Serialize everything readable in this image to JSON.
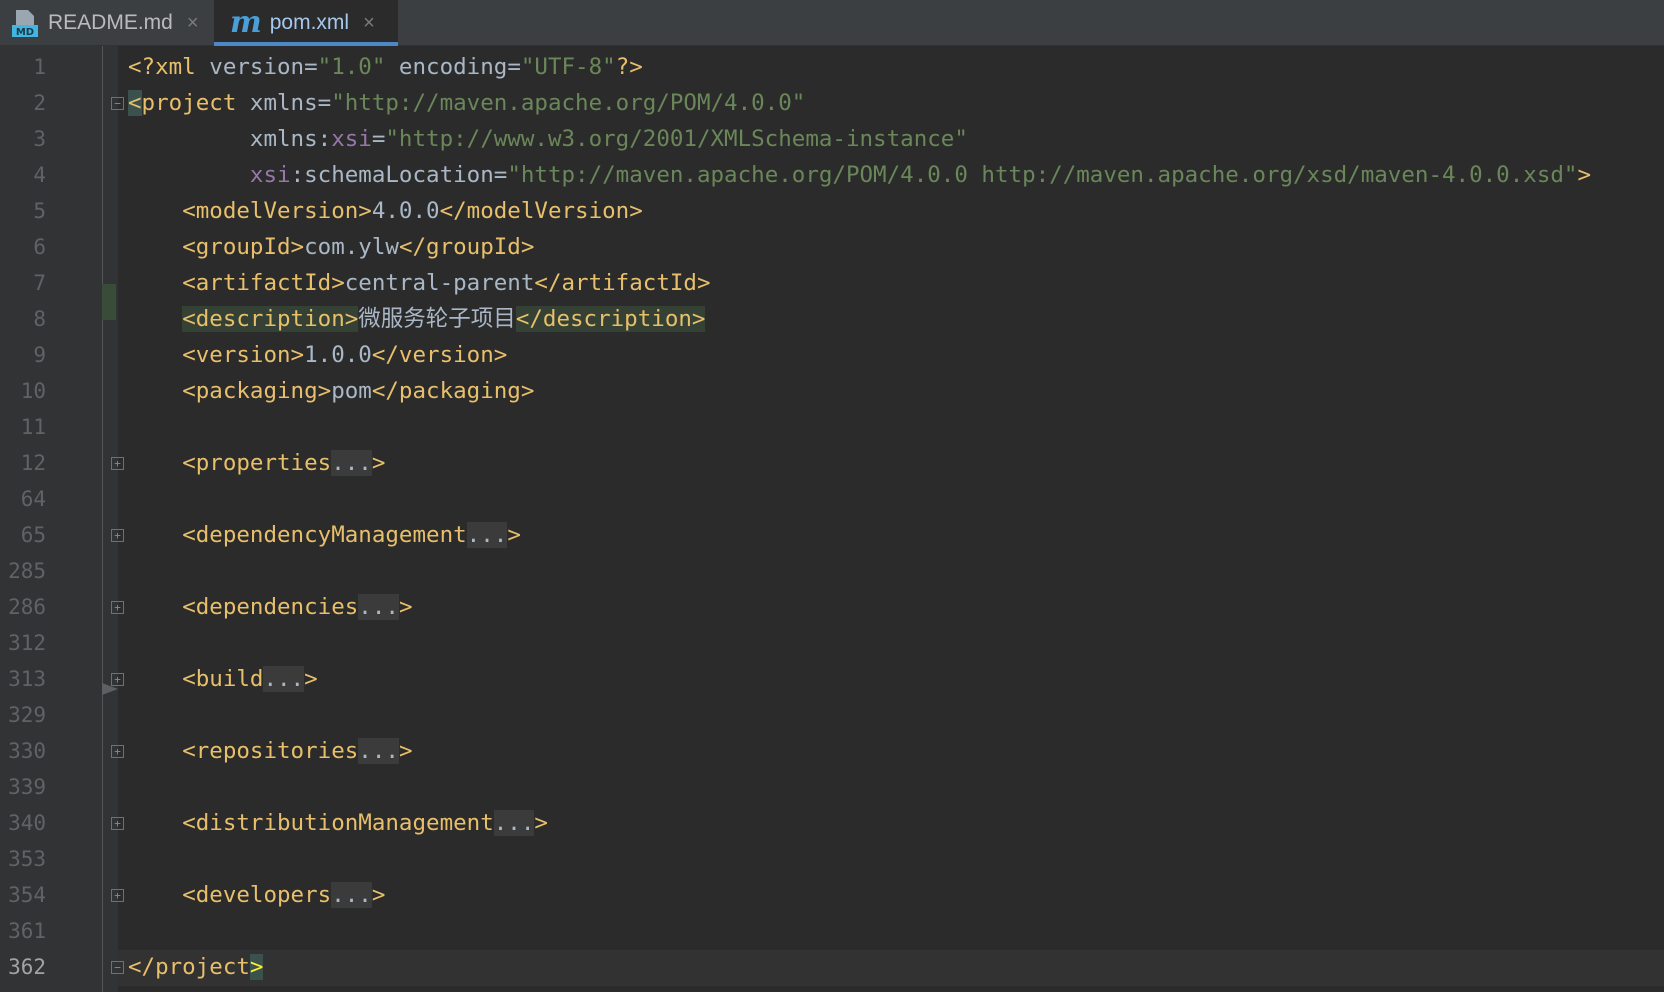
{
  "tabs": [
    {
      "label": "README.md",
      "icon": "markdown-file-icon",
      "active": false
    },
    {
      "label": "pom.xml",
      "icon": "maven-file-icon",
      "active": true
    }
  ],
  "icons": {
    "close": "×",
    "md_badge": "MD",
    "maven_letter": "m",
    "fold_plus": "+",
    "fold_minus": "−"
  },
  "colors": {
    "tag": "#e8bf6a",
    "string": "#6a8759",
    "namespace": "#9876aa",
    "text": "#a9b7c6",
    "active_tab_accent": "#4a88c7"
  },
  "editor": {
    "lines": [
      {
        "num": "1",
        "tag_open": "<?xml",
        "attr1": " version",
        "eq1": "=",
        "val1": "\"1.0\"",
        "attr2": " encoding",
        "eq2": "=",
        "val2": "\"UTF-8\"",
        "tag_close": "?>"
      },
      {
        "num": "2",
        "bracket": "<",
        "tag": "project",
        "attr": " xmlns",
        "eq": "=",
        "val": "\"http://maven.apache.org/POM/4.0.0\""
      },
      {
        "num": "3",
        "attr": "xmlns",
        "colon": ":",
        "ns": "xsi",
        "eq": "=",
        "val": "\"http://www.w3.org/2001/XMLSchema-instance\""
      },
      {
        "num": "4",
        "ns": "xsi",
        "colon": ":",
        "attr": "schemaLocation",
        "eq": "=",
        "val": "\"http://maven.apache.org/POM/4.0.0 http://maven.apache.org/xsd/maven-4.0.0.xsd\"",
        "tag_close": ">"
      },
      {
        "num": "5",
        "open": "<modelVersion>",
        "text": "4.0.0",
        "close": "</modelVersion>"
      },
      {
        "num": "6",
        "open": "<groupId>",
        "text": "com.ylw",
        "close": "</groupId>"
      },
      {
        "num": "7",
        "open": "<artifactId>",
        "text": "central-parent",
        "close": "</artifactId>"
      },
      {
        "num": "8",
        "open": "<description>",
        "text": "微服务轮子项目",
        "close": "</description>"
      },
      {
        "num": "9",
        "open": "<version>",
        "text": "1.0.0",
        "close": "</version>"
      },
      {
        "num": "10",
        "open": "<packaging>",
        "text": "pom",
        "close": "</packaging>"
      },
      {
        "num": "11"
      },
      {
        "num": "12",
        "open": "<properties",
        "dots": "...",
        "close": ">"
      },
      {
        "num": "64"
      },
      {
        "num": "65",
        "open": "<dependencyManagement",
        "dots": "...",
        "close": ">"
      },
      {
        "num": "285"
      },
      {
        "num": "286",
        "open": "<dependencies",
        "dots": "...",
        "close": ">"
      },
      {
        "num": "312"
      },
      {
        "num": "313",
        "open": "<build",
        "dots": "...",
        "close": ">"
      },
      {
        "num": "329"
      },
      {
        "num": "330",
        "open": "<repositories",
        "dots": "...",
        "close": ">"
      },
      {
        "num": "339"
      },
      {
        "num": "340",
        "open": "<distributionManagement",
        "dots": "...",
        "close": ">"
      },
      {
        "num": "353"
      },
      {
        "num": "354",
        "open": "<developers",
        "dots": "...",
        "close": ">"
      },
      {
        "num": "361"
      },
      {
        "num": "362",
        "open": "</project",
        "close": ">"
      }
    ]
  }
}
